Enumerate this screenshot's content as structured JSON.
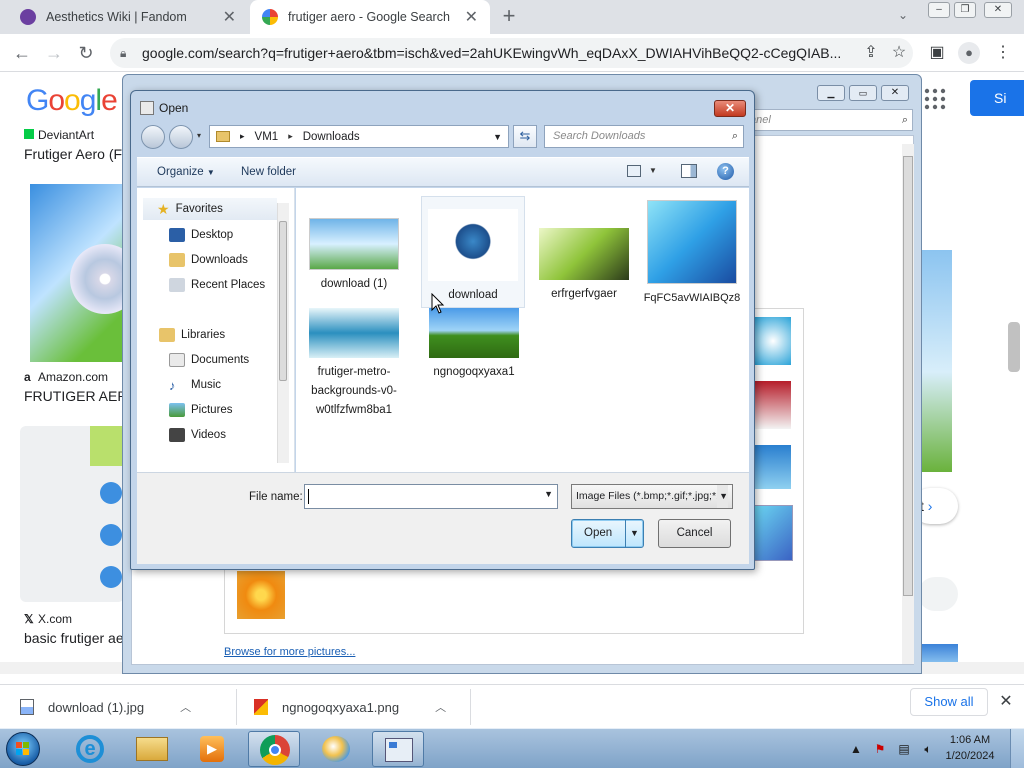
{
  "browser": {
    "tabs": [
      {
        "title": "Aesthetics Wiki | Fandom",
        "active": false
      },
      {
        "title": "frutiger aero - Google Search",
        "active": true
      }
    ],
    "url": "google.com/search?q=frutiger+aero&tbm=isch&ved=2ahUKEwingvWh_eqDAxX_DWIAHVihBeQQ2-cCegQIAB..."
  },
  "google": {
    "logo": "Google",
    "sign_in_partial": "Si",
    "results": [
      {
        "source": "DeviantArt",
        "title": "Frutiger Aero (F"
      },
      {
        "source": "Amazon.com",
        "title": "FRUTIGER AER("
      },
      {
        "source": "X.com",
        "title": "basic frutiger ae"
      }
    ],
    "browse_link": "Browse for more pictures...",
    "background_search_placeholder": "anel",
    "next_partial": "t"
  },
  "dialog": {
    "title": "Open",
    "breadcrumb": [
      "VM1",
      "Downloads"
    ],
    "search_placeholder": "Search Downloads",
    "toolbar": {
      "organize": "Organize",
      "new_folder": "New folder"
    },
    "nav": {
      "favorites": "Favorites",
      "favorites_items": [
        "Desktop",
        "Downloads",
        "Recent Places"
      ],
      "libraries": "Libraries",
      "libraries_items": [
        "Documents",
        "Music",
        "Pictures",
        "Videos"
      ]
    },
    "files": [
      {
        "name": "download (1)"
      },
      {
        "name": "download"
      },
      {
        "name": "erfrgerfvgaer"
      },
      {
        "name": "FqFC5avWIAIBQz8"
      },
      {
        "name": "frutiger-metro-backgrounds-v0-w0tlfzfwm8ba1"
      },
      {
        "name": "ngnogoqxyaxa1"
      }
    ],
    "file_name_label": "File name:",
    "file_name_value": "",
    "filter": "Image Files (*.bmp;*.gif;*.jpg;*.p",
    "open_label": "Open",
    "cancel_label": "Cancel"
  },
  "downloads": {
    "items": [
      "download (1).jpg",
      "ngnogoqxyaxa1.png"
    ],
    "show_all": "Show all"
  },
  "taskbar": {
    "time": "1:06 AM",
    "date": "1/20/2024"
  },
  "colors": {
    "chrome_blue": "#1a73e8",
    "dialog_frame": "#c3d5ea",
    "taskbar": "#8aadd1"
  }
}
